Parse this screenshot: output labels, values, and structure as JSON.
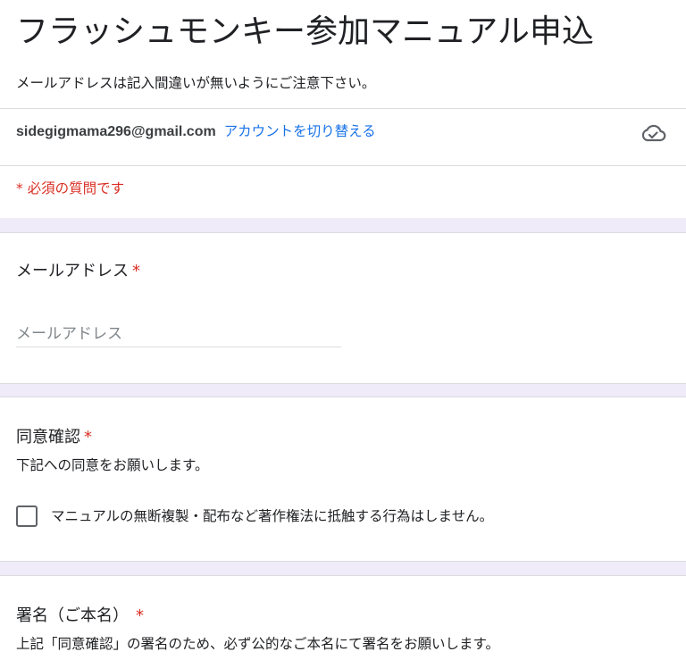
{
  "form": {
    "title": "フラッシュモンキー参加マニュアル申込",
    "description": "メールアドレスは記入間違いが無いようにご注意下さい。"
  },
  "account": {
    "email": "sidegigmama296@gmail.com",
    "switch_label": "アカウントを切り替える",
    "status_icon": "cloud-check-icon"
  },
  "required_note": "* 必須の質問です",
  "questions": [
    {
      "title": "メールアドレス",
      "required_mark": "*",
      "input_placeholder": "メールアドレス",
      "input_value": ""
    },
    {
      "title": "同意確認",
      "required_mark": "*",
      "description": "下記への同意をお願いします。",
      "checkbox_label": "マニュアルの無断複製・配布など著作権法に抵触する行為はしません。",
      "checked": false
    },
    {
      "title": "署名（ご本名）",
      "required_mark": "*",
      "description": "上記「同意確認」の署名のため、必ず公的なご本名にて署名をお願いします。"
    }
  ],
  "colors": {
    "accent": "#1a73e8",
    "required": "#d93025",
    "background_gap": "#f0ebf8",
    "divider": "#dadce0"
  }
}
